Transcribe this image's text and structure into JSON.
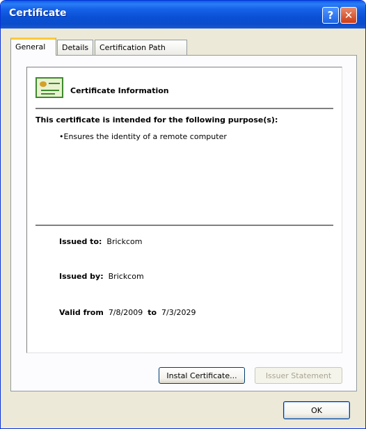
{
  "window": {
    "title": "Certificate",
    "help_label": "?",
    "close_label": "✕"
  },
  "tabs": [
    {
      "label": "General",
      "active": true
    },
    {
      "label": "Details",
      "active": false
    },
    {
      "label": "Certification Path",
      "active": false
    }
  ],
  "general": {
    "info_title": "Certificate Information",
    "purpose_heading": "This certificate is intended for the following purpose(s):",
    "purposes": [
      "•Ensures the identity of a remote computer"
    ],
    "issued_to_label": "Issued to:",
    "issued_to_value": "Brickcom",
    "issued_by_label": "Issued by:",
    "issued_by_value": "Brickcom",
    "valid_from_label": "Valid from",
    "valid_from_value": "7/8/2009",
    "valid_to_label": "to",
    "valid_to_value": "7/3/2029"
  },
  "buttons": {
    "install": "Instal Certificate...",
    "issuer": "Issuer Statement",
    "ok": "OK"
  },
  "icons": {
    "certificate": "certificate-icon",
    "help": "help-icon",
    "close": "close-icon"
  },
  "colors": {
    "titlebar": "#0a50d5",
    "face": "#ece9d8",
    "tab_highlight": "#ffc83c"
  }
}
